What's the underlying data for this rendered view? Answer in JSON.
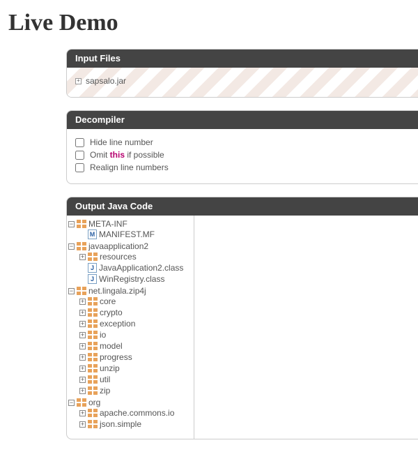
{
  "title": "Live Demo",
  "input": {
    "header": "Input Files",
    "file": "sapsalo.jar"
  },
  "decompiler": {
    "header": "Decompiler",
    "opts": {
      "hide": "Hide line number",
      "omit_pre": "Omit ",
      "omit_kw": "this",
      "omit_post": " if possible",
      "realign": "Realign line numbers"
    }
  },
  "output": {
    "header": "Output Java Code",
    "tree": {
      "metainf": "META-INF",
      "manifest": "MANIFEST.MF",
      "javaapp": "javaapplication2",
      "resources": "resources",
      "javaapp2class": "JavaApplication2.class",
      "winreg": "WinRegistry.class",
      "zip4j": "net.lingala.zip4j",
      "core": "core",
      "crypto": "crypto",
      "exception": "exception",
      "io": "io",
      "model": "model",
      "progress": "progress",
      "unzip": "unzip",
      "util": "util",
      "zip": "zip",
      "org": "org",
      "apacheio": "apache.commons.io",
      "jsonsimple": "json.simple"
    }
  },
  "glyphs": {
    "J": "J",
    "M": "M"
  }
}
